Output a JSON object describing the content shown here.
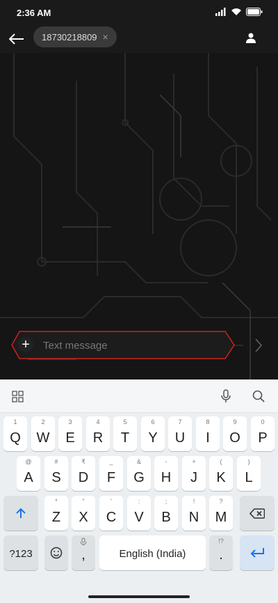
{
  "status_bar": {
    "time": "2:36 AM",
    "icons": [
      "signal-icon",
      "wifi-icon",
      "battery-icon"
    ]
  },
  "header": {
    "back_icon": "back-arrow-icon",
    "recipient": "18730218809",
    "chip_close": "×",
    "contact_icon": "person-icon"
  },
  "compose": {
    "placeholder": "Text message",
    "plus": "+",
    "send_icon": "chevron-right-icon"
  },
  "keyboard": {
    "toolbar": {
      "apps_icon": "grid-icon",
      "mic_icon": "microphone-icon",
      "search_icon": "search-icon"
    },
    "row1": [
      {
        "label": "Q",
        "hint": "1"
      },
      {
        "label": "W",
        "hint": "2"
      },
      {
        "label": "E",
        "hint": "3"
      },
      {
        "label": "R",
        "hint": "4"
      },
      {
        "label": "T",
        "hint": "5"
      },
      {
        "label": "Y",
        "hint": "6"
      },
      {
        "label": "U",
        "hint": "7"
      },
      {
        "label": "I",
        "hint": "8"
      },
      {
        "label": "O",
        "hint": "9"
      },
      {
        "label": "P",
        "hint": "0"
      }
    ],
    "row2": [
      {
        "label": "A",
        "hint": "@"
      },
      {
        "label": "S",
        "hint": "#"
      },
      {
        "label": "D",
        "hint": "₹"
      },
      {
        "label": "F",
        "hint": "_"
      },
      {
        "label": "G",
        "hint": "&"
      },
      {
        "label": "H",
        "hint": "-"
      },
      {
        "label": "J",
        "hint": "+"
      },
      {
        "label": "K",
        "hint": "("
      },
      {
        "label": "L",
        "hint": ")"
      }
    ],
    "row3": [
      {
        "label": "Z",
        "hint": "*"
      },
      {
        "label": "X",
        "hint": "\""
      },
      {
        "label": "C",
        "hint": "'"
      },
      {
        "label": "V",
        "hint": ":"
      },
      {
        "label": "B",
        "hint": ";"
      },
      {
        "label": "N",
        "hint": "!"
      },
      {
        "label": "M",
        "hint": "?"
      }
    ],
    "shift_icon": "shift-arrow-icon",
    "backspace_icon": "backspace-icon",
    "symbols_label": "?123",
    "emoji_icon": "emoji-icon",
    "comma_label": ",",
    "space_label": "English (India)",
    "period_label": ".",
    "period_hint": "!?",
    "enter_icon": "enter-arrow-icon"
  },
  "colors": {
    "accent_red": "#d0201c",
    "enter_blue": "#1a73e8",
    "background": "#151515"
  }
}
